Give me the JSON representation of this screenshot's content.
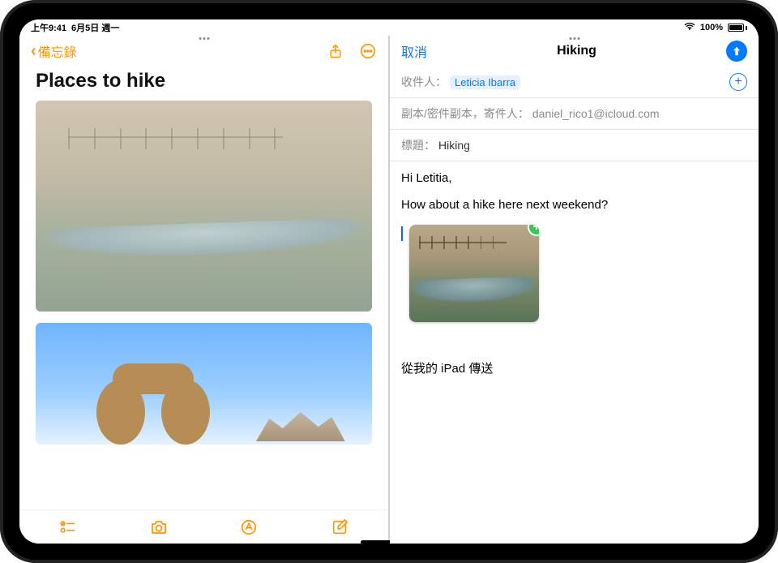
{
  "status": {
    "time": "上午9:41",
    "date": "6月5日 週一",
    "battery_pct": "100%"
  },
  "notes": {
    "back_label": "備忘錄",
    "title": "Places to hike"
  },
  "mail": {
    "cancel": "取消",
    "title": "Hiking",
    "to_label": "收件人：",
    "to_name": "Leticia Ibarra",
    "cc_label": "副本/密件副本，寄件人：",
    "cc_value": "daniel_rico1@icloud.com",
    "subject_label": "標題：",
    "subject_value": "Hiking",
    "body_line1": "Hi Letitia,",
    "body_line2": "How about a hike here next weekend?",
    "signature": "從我的 iPad 傳送"
  }
}
